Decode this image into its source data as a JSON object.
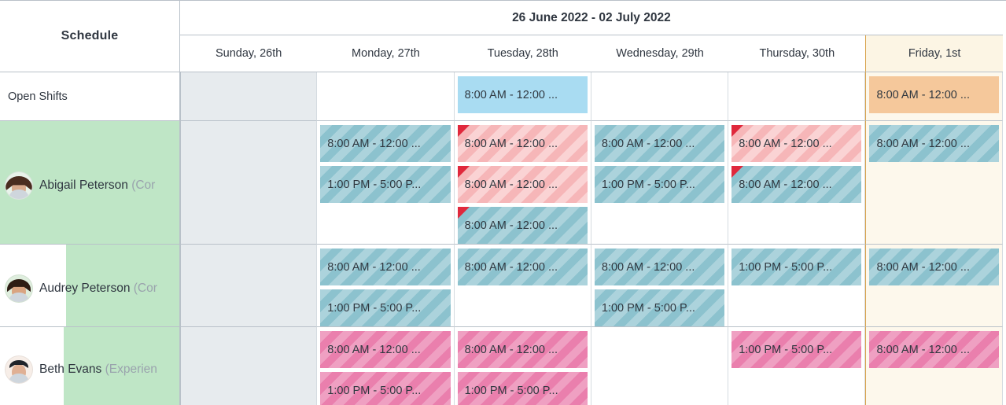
{
  "header": {
    "title": "Schedule",
    "date_range": "26 June 2022 - 02 July 2022",
    "days": [
      {
        "label": "Sunday, 26th",
        "off_day": true,
        "highlight": false
      },
      {
        "label": "Monday, 27th",
        "off_day": false,
        "highlight": false
      },
      {
        "label": "Tuesday, 28th",
        "off_day": false,
        "highlight": false
      },
      {
        "label": "Wednesday, 29th",
        "off_day": false,
        "highlight": false
      },
      {
        "label": "Thursday, 30th",
        "off_day": false,
        "highlight": false
      },
      {
        "label": "Friday, 1st",
        "off_day": false,
        "highlight": true
      }
    ]
  },
  "labels": {
    "open_shifts": "Open Shifts",
    "shift_morning": "8:00 AM - 12:00 ...",
    "shift_afternoon": "1:00 PM - 5:00 P..."
  },
  "rows": [
    {
      "kind": "open-shifts",
      "name": "Open Shifts",
      "cells": [
        {
          "shifts": []
        },
        {
          "shifts": []
        },
        {
          "shifts": [
            {
              "label": "8:00 AM - 12:00 ...",
              "style": "solid-blue",
              "conflict": false
            }
          ]
        },
        {
          "shifts": []
        },
        {
          "shifts": []
        },
        {
          "shifts": [
            {
              "label": "8:00 AM - 12:00 ...",
              "style": "solid-orange",
              "conflict": false
            }
          ]
        }
      ]
    },
    {
      "kind": "employee",
      "name": "Abigail Peterson ",
      "role": "(Cor",
      "avatar": "abigail-avatar",
      "avail_width": 229,
      "cells": [
        {
          "shifts": []
        },
        {
          "shifts": [
            {
              "label": "8:00 AM - 12:00 ...",
              "style": "striped-teal",
              "conflict": false
            },
            {
              "label": "1:00 PM - 5:00 P...",
              "style": "striped-teal",
              "conflict": false
            }
          ]
        },
        {
          "shifts": [
            {
              "label": "8:00 AM - 12:00 ...",
              "style": "striped-pinklight",
              "conflict": true
            },
            {
              "label": "8:00 AM - 12:00 ...",
              "style": "striped-pinklight",
              "conflict": true
            },
            {
              "label": "8:00 AM - 12:00 ...",
              "style": "striped-teal",
              "conflict": true
            }
          ]
        },
        {
          "shifts": [
            {
              "label": "8:00 AM - 12:00 ...",
              "style": "striped-teal",
              "conflict": false
            },
            {
              "label": "1:00 PM - 5:00 P...",
              "style": "striped-teal",
              "conflict": false
            }
          ]
        },
        {
          "shifts": [
            {
              "label": "8:00 AM - 12:00 ...",
              "style": "striped-pinklight",
              "conflict": true
            },
            {
              "label": "8:00 AM - 12:00 ...",
              "style": "striped-teal",
              "conflict": true
            }
          ]
        },
        {
          "shifts": [
            {
              "label": "8:00 AM - 12:00 ...",
              "style": "striped-teal",
              "conflict": false
            }
          ]
        }
      ]
    },
    {
      "kind": "employee",
      "name": "Audrey Peterson ",
      "role": "(Cor",
      "avatar": "audrey-avatar",
      "avail_width": 144,
      "cells": [
        {
          "shifts": []
        },
        {
          "shifts": [
            {
              "label": "8:00 AM - 12:00 ...",
              "style": "striped-teal",
              "conflict": false
            },
            {
              "label": "1:00 PM - 5:00 P...",
              "style": "striped-teal",
              "conflict": false
            }
          ]
        },
        {
          "shifts": [
            {
              "label": "8:00 AM - 12:00 ...",
              "style": "striped-teal",
              "conflict": false
            }
          ]
        },
        {
          "shifts": [
            {
              "label": "8:00 AM - 12:00 ...",
              "style": "striped-teal",
              "conflict": false
            },
            {
              "label": "1:00 PM - 5:00 P...",
              "style": "striped-teal",
              "conflict": false
            }
          ]
        },
        {
          "shifts": [
            {
              "label": "1:00 PM - 5:00 P...",
              "style": "striped-teal",
              "conflict": false
            }
          ]
        },
        {
          "shifts": [
            {
              "label": "8:00 AM - 12:00 ...",
              "style": "striped-teal",
              "conflict": false
            }
          ]
        }
      ]
    },
    {
      "kind": "employee",
      "name": "Beth Evans ",
      "role": "(Experien",
      "avatar": "beth-avatar",
      "avail_width": 147,
      "cells": [
        {
          "shifts": []
        },
        {
          "shifts": [
            {
              "label": "8:00 AM - 12:00 ...",
              "style": "striped-pink",
              "conflict": false
            },
            {
              "label": "1:00 PM - 5:00 P...",
              "style": "striped-pink",
              "conflict": false
            }
          ]
        },
        {
          "shifts": [
            {
              "label": "8:00 AM - 12:00 ...",
              "style": "striped-pink",
              "conflict": false
            },
            {
              "label": "1:00 PM - 5:00 P...",
              "style": "striped-pink",
              "conflict": false
            }
          ]
        },
        {
          "shifts": []
        },
        {
          "shifts": [
            {
              "label": "1:00 PM - 5:00 P...",
              "style": "striped-pink",
              "conflict": false
            }
          ]
        },
        {
          "shifts": [
            {
              "label": "8:00 AM - 12:00 ...",
              "style": "striped-pink",
              "conflict": false
            }
          ]
        }
      ]
    }
  ],
  "colors": {
    "open_shift_blue": "#a9dcf2",
    "open_shift_orange": "#f5c89b",
    "shift_teal": "#8cc2ce",
    "shift_pink_light": "#f6b6b8",
    "shift_pink": "#ea7fad",
    "availability_green": "#bfe6c6",
    "conflict_red": "#e0283c",
    "highlight_column": "#fdf8ec",
    "off_day": "#e7ebee"
  }
}
